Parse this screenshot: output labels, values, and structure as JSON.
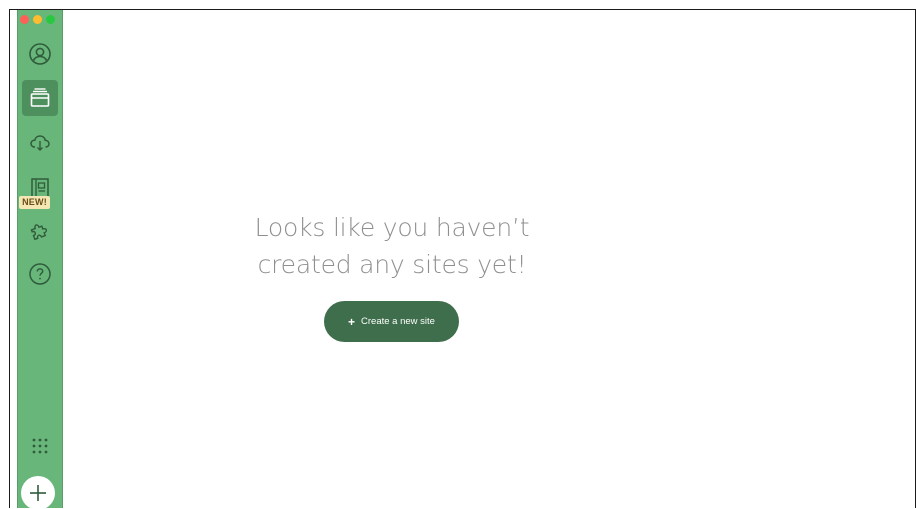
{
  "window": {
    "traffic_lights": {
      "close_color": "#ff5f57",
      "minimize_color": "#febc2e",
      "maximize_color": "#28c840"
    }
  },
  "sidebar": {
    "background": "#69b67b",
    "items": [
      {
        "name": "account",
        "icon": "user-avatar-icon",
        "active": false
      },
      {
        "name": "sites",
        "icon": "sites-stack-icon",
        "active": true
      },
      {
        "name": "connect",
        "icon": "cloud-download-icon",
        "active": false
      },
      {
        "name": "blueprints",
        "icon": "blueprint-icon",
        "active": false,
        "badge": "NEW!"
      },
      {
        "name": "add-ons",
        "icon": "puzzle-piece-icon",
        "active": false
      },
      {
        "name": "help",
        "icon": "help-circle-icon",
        "active": false
      }
    ],
    "new_badge": "NEW!",
    "bottom": {
      "menu_icon": "grid-dots-icon",
      "add_icon": "plus-icon"
    }
  },
  "main": {
    "empty_state": {
      "line1": "Looks like you haven’t",
      "line2": "created any sites yet!"
    },
    "create_button": {
      "icon": "+",
      "label": "Create a new site",
      "color": "#3f6e4c"
    }
  }
}
